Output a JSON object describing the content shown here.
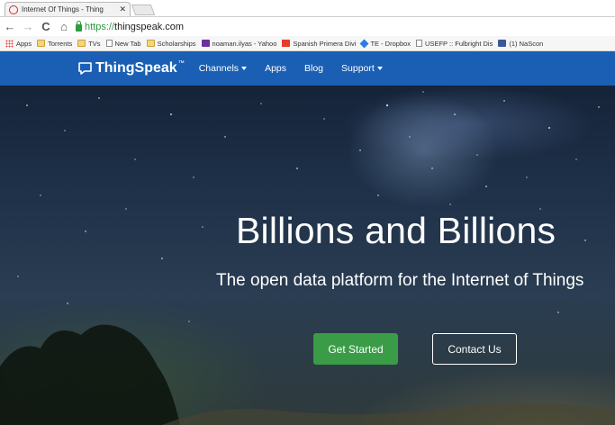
{
  "browser": {
    "tab": {
      "title": "Internet Of Things - Thing",
      "close_symbol": "✕"
    },
    "toolbar": {
      "back_symbol": "←",
      "forward_symbol": "→",
      "reload_symbol": "C",
      "home_symbol": "⌂",
      "url_protocol": "https://",
      "url_host": "thingspeak.com"
    },
    "bookmarks": [
      {
        "label": "Apps",
        "icon": "apps-icon"
      },
      {
        "label": "Torrents",
        "icon": "folder-icon"
      },
      {
        "label": "TVs",
        "icon": "folder-icon"
      },
      {
        "label": "New Tab",
        "icon": "page-icon"
      },
      {
        "label": "Scholarships",
        "icon": "folder-icon"
      },
      {
        "label": "noaman.ilyas - Yahoo",
        "icon": "mail-icon"
      },
      {
        "label": "Spanish Primera Divi",
        "icon": "flag-icon"
      },
      {
        "label": "TE - Dropbox",
        "icon": "dropbox-icon"
      },
      {
        "label": "USEFP :: Fulbright Dis",
        "icon": "page-icon"
      },
      {
        "label": "(1) NaScon",
        "icon": "facebook-icon"
      }
    ]
  },
  "site": {
    "brand": {
      "name": "ThingSpeak",
      "trademark": "™"
    },
    "nav": [
      {
        "label": "Channels",
        "dropdown": true
      },
      {
        "label": "Apps",
        "dropdown": false
      },
      {
        "label": "Blog",
        "dropdown": false
      },
      {
        "label": "Support",
        "dropdown": true
      }
    ],
    "hero": {
      "title": "Billions and Billions",
      "subtitle": "The open data platform for the Internet of Things"
    },
    "buttons": {
      "primary": "Get Started",
      "secondary": "Contact Us"
    }
  },
  "colors": {
    "site_nav": "#1a5fb4",
    "primary_button": "#3a9c46",
    "secure_green": "#2d9c3f"
  }
}
